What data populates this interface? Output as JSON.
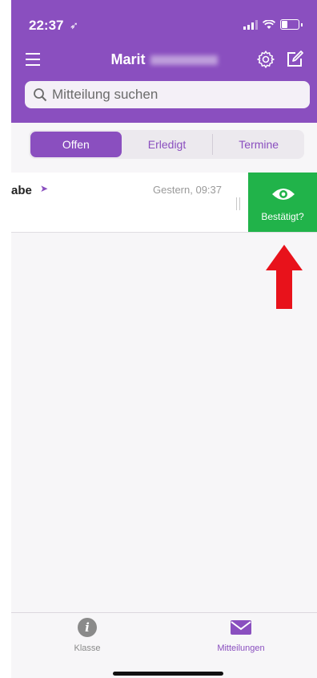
{
  "status_bar": {
    "time": "22:37",
    "location_arrow": "➶"
  },
  "header": {
    "title": "Marit",
    "search_placeholder": "Mitteilung suchen"
  },
  "tabs": [
    {
      "label": "Offen",
      "active": true
    },
    {
      "label": "Erledigt",
      "active": false
    },
    {
      "label": "Termine",
      "active": false
    }
  ],
  "message": {
    "title": "abe",
    "date": "Gestern, 09:37"
  },
  "swipe_action": {
    "label": "Bestätigt?",
    "icon": "eye-icon",
    "color": "#21b34a"
  },
  "tabbar": {
    "items": [
      {
        "label": "Klasse",
        "icon": "info-icon",
        "active": false
      },
      {
        "label": "Mitteilungen",
        "icon": "mail-icon",
        "active": true
      }
    ]
  },
  "colors": {
    "brand": "#8a4fbf",
    "confirm": "#21b34a",
    "annotation_arrow": "#e8121b"
  }
}
